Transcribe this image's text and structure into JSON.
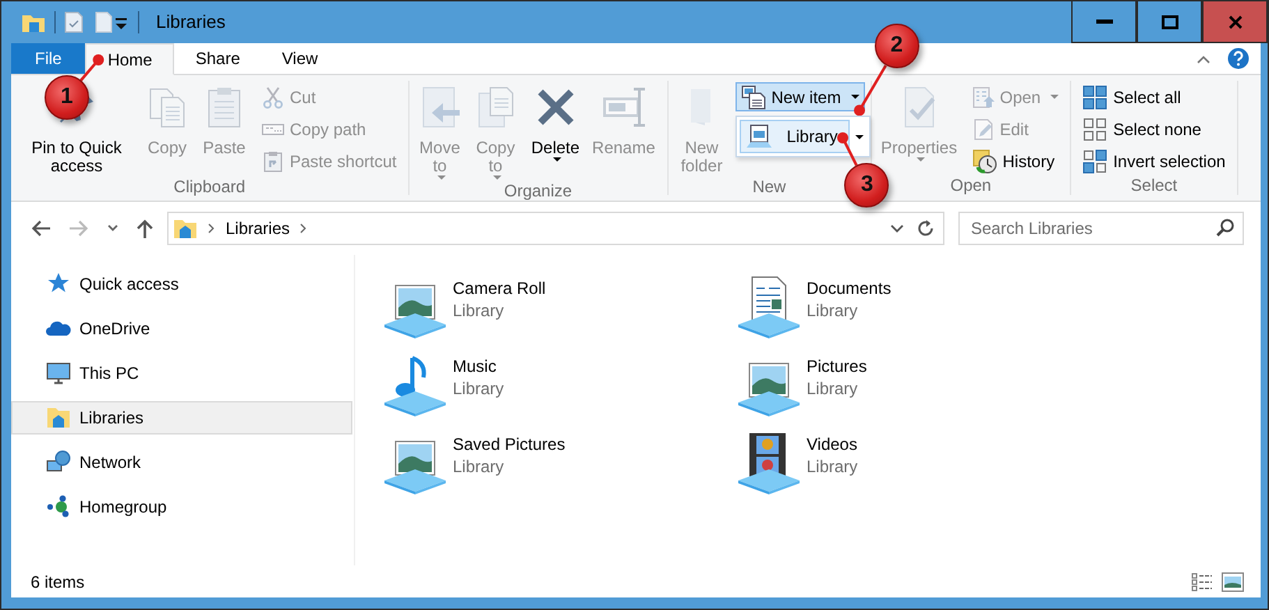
{
  "window": {
    "title": "Libraries"
  },
  "ribbon_tabs": [
    {
      "label": "File",
      "kind": "file",
      "selected": false
    },
    {
      "label": "Home",
      "kind": "tab",
      "selected": true
    },
    {
      "label": "Share",
      "kind": "tab",
      "selected": false
    },
    {
      "label": "View",
      "kind": "tab",
      "selected": false
    }
  ],
  "ribbon_groups": [
    {
      "label": "Clipboard",
      "items": [
        {
          "label": "Pin to Quick access",
          "kind": "large",
          "disabled": false,
          "dropdown": false
        },
        {
          "label": "Copy",
          "kind": "large",
          "disabled": true,
          "dropdown": false
        },
        {
          "label": "Paste",
          "kind": "large",
          "disabled": true,
          "dropdown": false
        },
        {
          "label": "Cut",
          "kind": "small",
          "disabled": true,
          "dropdown": false
        },
        {
          "label": "Copy path",
          "kind": "small",
          "disabled": true,
          "dropdown": false
        },
        {
          "label": "Paste shortcut",
          "kind": "small",
          "disabled": true,
          "dropdown": false
        }
      ]
    },
    {
      "label": "Organize",
      "items": [
        {
          "label": "Move to",
          "kind": "large",
          "disabled": true,
          "dropdown": true
        },
        {
          "label": "Copy to",
          "kind": "large",
          "disabled": true,
          "dropdown": true
        },
        {
          "label": "Delete",
          "kind": "large",
          "disabled": false,
          "dropdown": true
        },
        {
          "label": "Rename",
          "kind": "large",
          "disabled": true,
          "dropdown": false
        }
      ]
    },
    {
      "label": "New",
      "items": [
        {
          "label": "New folder",
          "kind": "large",
          "disabled": true,
          "dropdown": false
        },
        {
          "label": "New item",
          "kind": "small",
          "disabled": false,
          "dropdown": true,
          "expanded": true
        }
      ]
    },
    {
      "label": "Open",
      "items": [
        {
          "label": "Properties",
          "kind": "large",
          "disabled": true,
          "dropdown": true
        },
        {
          "label": "Open",
          "kind": "small",
          "disabled": true,
          "dropdown": true
        },
        {
          "label": "Edit",
          "kind": "small",
          "disabled": true,
          "dropdown": false
        },
        {
          "label": "History",
          "kind": "small",
          "disabled": false,
          "dropdown": false
        }
      ]
    },
    {
      "label": "Select",
      "items": [
        {
          "label": "Select all",
          "kind": "small",
          "disabled": false,
          "dropdown": false
        },
        {
          "label": "Select none",
          "kind": "small",
          "disabled": false,
          "dropdown": false
        },
        {
          "label": "Invert selection",
          "kind": "small",
          "disabled": false,
          "dropdown": false
        }
      ]
    }
  ],
  "new_item_menu": [
    {
      "label": "Library"
    }
  ],
  "address": {
    "breadcrumb": [
      "Libraries"
    ]
  },
  "search": {
    "placeholder": "Search Libraries"
  },
  "nav_pane": [
    {
      "label": "Quick access",
      "selected": false
    },
    {
      "label": "OneDrive",
      "selected": false
    },
    {
      "label": "This PC",
      "selected": false
    },
    {
      "label": "Libraries",
      "selected": true
    },
    {
      "label": "Network",
      "selected": false
    },
    {
      "label": "Homegroup",
      "selected": false
    }
  ],
  "libraries": [
    {
      "name": "Camera Roll",
      "type": "Library"
    },
    {
      "name": "Documents",
      "type": "Library"
    },
    {
      "name": "Music",
      "type": "Library"
    },
    {
      "name": "Pictures",
      "type": "Library"
    },
    {
      "name": "Saved Pictures",
      "type": "Library"
    },
    {
      "name": "Videos",
      "type": "Library"
    }
  ],
  "status_bar": {
    "item_count": "6 items"
  },
  "callouts": [
    {
      "number": "1"
    },
    {
      "number": "2"
    },
    {
      "number": "3"
    }
  ]
}
